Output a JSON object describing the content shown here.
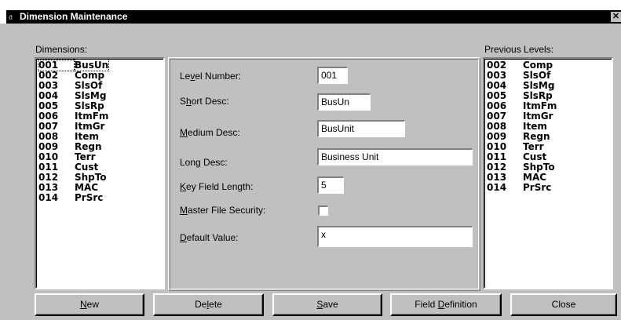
{
  "window": {
    "title": "Dimension Maintenance",
    "close_glyph": "✕"
  },
  "dimensions": {
    "label": "Dimensions:",
    "selected_index": 0,
    "items": [
      {
        "code": "001",
        "name": "BusUn"
      },
      {
        "code": "002",
        "name": "Comp"
      },
      {
        "code": "003",
        "name": "SlsOf"
      },
      {
        "code": "004",
        "name": "SlsMg"
      },
      {
        "code": "005",
        "name": "SlsRp"
      },
      {
        "code": "006",
        "name": "ItmFm"
      },
      {
        "code": "007",
        "name": "ItmGr"
      },
      {
        "code": "008",
        "name": "Item"
      },
      {
        "code": "009",
        "name": "Regn"
      },
      {
        "code": "010",
        "name": "Terr"
      },
      {
        "code": "011",
        "name": "Cust"
      },
      {
        "code": "012",
        "name": "ShpTo"
      },
      {
        "code": "013",
        "name": "MAC"
      },
      {
        "code": "014",
        "name": "PrSrc"
      }
    ]
  },
  "previous_levels": {
    "label": "Previous Levels:",
    "items": [
      {
        "code": "002",
        "name": "Comp"
      },
      {
        "code": "003",
        "name": "SlsOf"
      },
      {
        "code": "004",
        "name": "SlsMg"
      },
      {
        "code": "005",
        "name": "SlsRp"
      },
      {
        "code": "006",
        "name": "ItmFm"
      },
      {
        "code": "007",
        "name": "ItmGr"
      },
      {
        "code": "008",
        "name": "Item"
      },
      {
        "code": "009",
        "name": "Regn"
      },
      {
        "code": "010",
        "name": "Terr"
      },
      {
        "code": "011",
        "name": "Cust"
      },
      {
        "code": "012",
        "name": "ShpTo"
      },
      {
        "code": "013",
        "name": "MAC"
      },
      {
        "code": "014",
        "name": "PrSrc"
      }
    ]
  },
  "form": {
    "level_number": {
      "label_pre": "Le",
      "label_key": "v",
      "label_post": "el Number:",
      "value": "001"
    },
    "short_desc": {
      "label_pre": "S",
      "label_key": "h",
      "label_post": "ort Desc:",
      "value": "BusUn"
    },
    "medium_desc": {
      "label_pre": "",
      "label_key": "M",
      "label_post": "edium Desc:",
      "value": "BusUnit"
    },
    "long_desc": {
      "label_pre": "Lon",
      "label_key": "g",
      "label_post": " Desc:",
      "value": "Business Unit"
    },
    "key_field_length": {
      "label_pre": "",
      "label_key": "K",
      "label_post": "ey Field Length:",
      "value": "5"
    },
    "master_file_security": {
      "label_pre": "",
      "label_key": "M",
      "label_post": "aster File Security:",
      "checked": false
    },
    "default_value": {
      "label_pre": "",
      "label_key": "D",
      "label_post": "efault Value:",
      "value": "x"
    }
  },
  "buttons": {
    "new": {
      "pre": "",
      "key": "N",
      "post": "ew"
    },
    "delete": {
      "pre": "De",
      "key": "l",
      "post": "ete"
    },
    "save": {
      "pre": "",
      "key": "S",
      "post": "ave"
    },
    "field_definition": {
      "pre": "Field ",
      "key": "D",
      "post": "efinition"
    },
    "close": {
      "pre": "Close",
      "key": "",
      "post": ""
    }
  }
}
